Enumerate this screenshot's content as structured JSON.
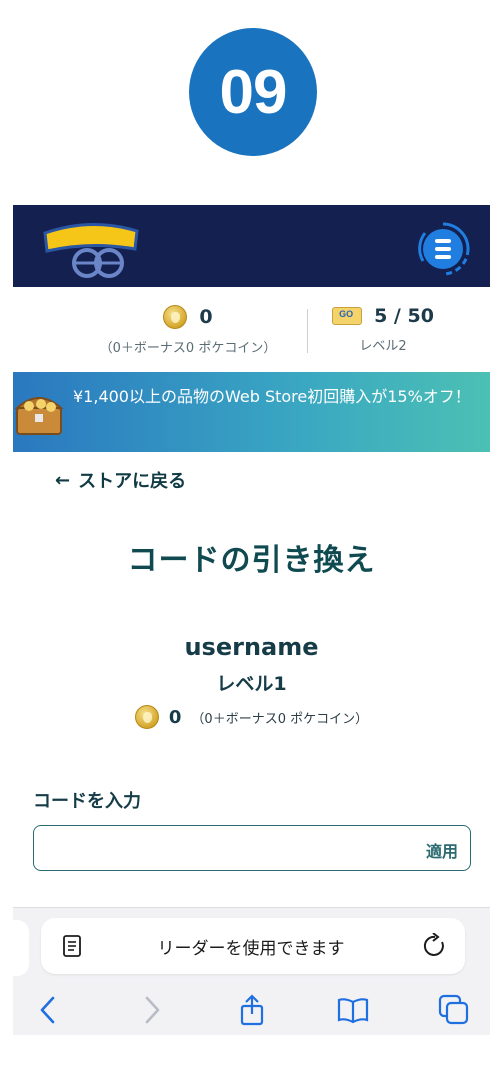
{
  "step_badge": "09",
  "stats": {
    "coins": "0",
    "coins_detail": "（0＋ボーナス0 ポケコイン）",
    "storage": "5 / 50",
    "level": "レベル2"
  },
  "promo": {
    "text": "¥1,400以上の品物のWeb Store初回購入が15%オフ！"
  },
  "nav": {
    "back": "ストアに戻る"
  },
  "page": {
    "title": "コードの引き換え"
  },
  "profile": {
    "username": "username",
    "level": "レベル1",
    "coins": "0",
    "coins_detail": "（0＋ボーナス0 ポケコイン）"
  },
  "redeem": {
    "label": "コードを入力",
    "input_value": "",
    "apply": "適用"
  },
  "browser": {
    "address_text": "リーダーを使用できます"
  },
  "icons": {
    "menu": "menu-list-icon",
    "coin": "pokecoin-icon",
    "storage": "item-storage-icon",
    "chest": "treasure-chest-icon",
    "reader": "reader-icon",
    "reload": "reload-icon",
    "back": "chevron-left-icon",
    "forward": "chevron-right-icon",
    "share": "share-icon",
    "bookmarks": "book-icon",
    "tabs": "tabs-icon"
  },
  "colors": {
    "header_bg": "#142050",
    "badge": "#1a73bf",
    "heading": "#0f4a50",
    "ios_blue": "#1f6fe0"
  }
}
